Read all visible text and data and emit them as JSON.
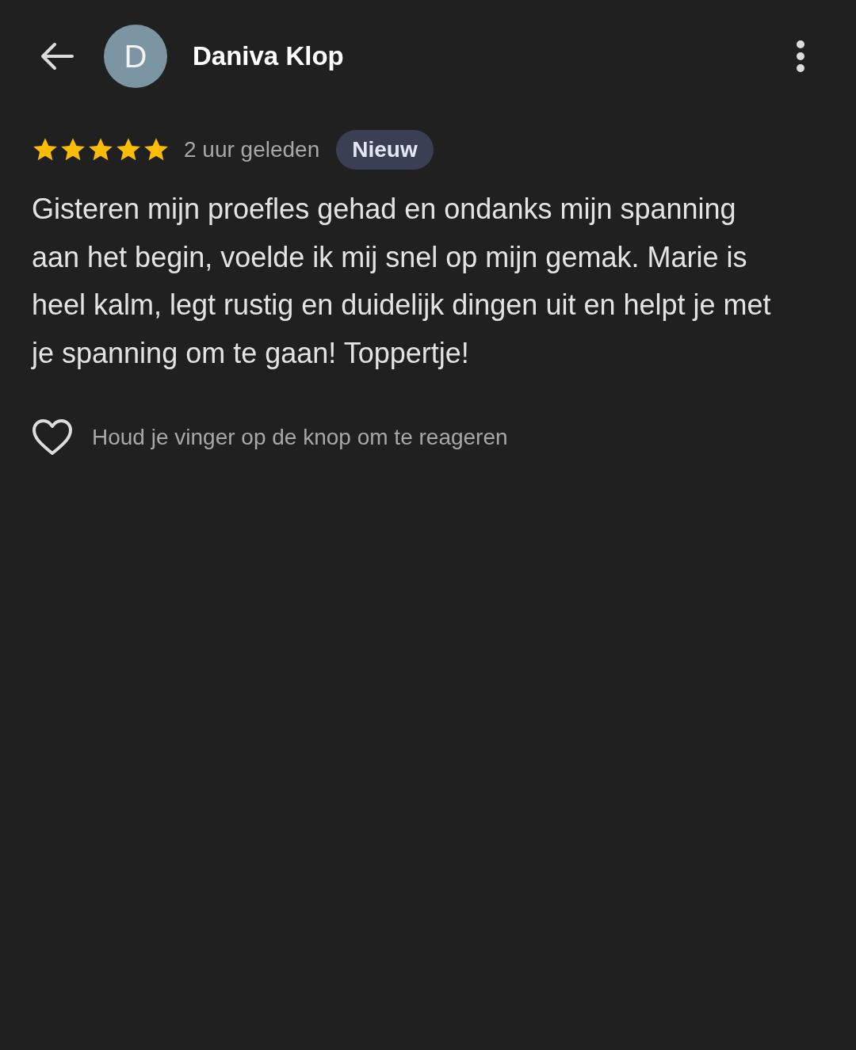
{
  "header": {
    "avatar_letter": "D",
    "name": "Daniva Klop"
  },
  "review": {
    "stars": 5,
    "time": "2 uur geleden",
    "badge": "Nieuw",
    "text": "Gisteren mijn proefles gehad en ondanks mijn spanning aan het begin, voelde ik mij snel op mijn gemak. Marie is heel kalm, legt rustig en duidelijk dingen uit en helpt je met je spanning om te gaan! Toppertje!"
  },
  "reaction": {
    "hint": "Houd je vinger op de knop om te reageren"
  }
}
